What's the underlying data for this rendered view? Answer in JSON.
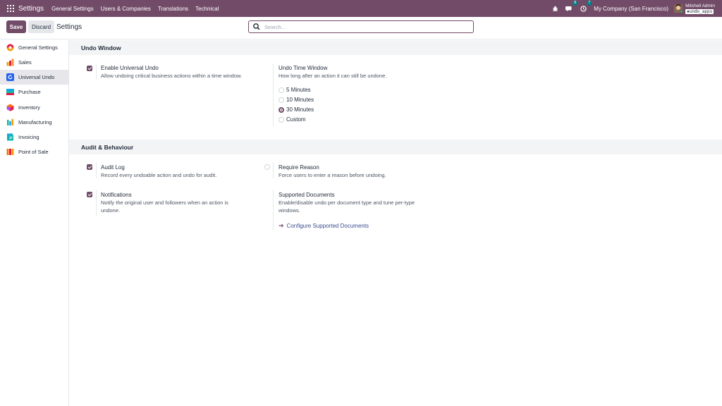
{
  "navbar": {
    "brand": "Settings",
    "menu": [
      "General Settings",
      "Users & Companies",
      "Translations",
      "Technical"
    ],
    "messages_count": "8",
    "activities_count": "7",
    "company": "My Company (San Francisco)",
    "user_name": "Mitchell Admin",
    "database": "undo_apps"
  },
  "control_panel": {
    "save_label": "Save",
    "discard_label": "Discard",
    "title": "Settings",
    "search_placeholder": "Search..."
  },
  "sidebar": {
    "items": [
      {
        "label": "General Settings",
        "icon": "general-settings-icon",
        "active": false
      },
      {
        "label": "Sales",
        "icon": "sales-icon",
        "active": false
      },
      {
        "label": "Universal Undo",
        "icon": "universal-undo-icon",
        "active": true
      },
      {
        "label": "Purchase",
        "icon": "purchase-icon",
        "active": false
      },
      {
        "label": "Inventory",
        "icon": "inventory-icon",
        "active": false
      },
      {
        "label": "Manufacturing",
        "icon": "manufacturing-icon",
        "active": false
      },
      {
        "label": "Invoicing",
        "icon": "invoicing-icon",
        "active": false
      },
      {
        "label": "Point of Sale",
        "icon": "point-of-sale-icon",
        "active": false
      }
    ]
  },
  "sections": {
    "undo_window": {
      "title": "Undo Window",
      "enable": {
        "title": "Enable Universal Undo",
        "desc": "Allow undoing critical business actions within a time window.",
        "checked": true
      },
      "time_window": {
        "title": "Undo Time Window",
        "desc": "How long after an action it can still be undone.",
        "options": [
          "5 Minutes",
          "10 Minutes",
          "30 Minutes",
          "Custom"
        ],
        "selected": "30 Minutes"
      }
    },
    "audit": {
      "title": "Audit & Behaviour",
      "audit_log": {
        "title": "Audit Log",
        "desc": "Record every undoable action and undo for audit.",
        "checked": true
      },
      "require_reason": {
        "title": "Require Reason",
        "desc": "Force users to enter a reason before undoing.",
        "checked": false
      },
      "notifications": {
        "title": "Notifications",
        "desc": "Notify the original user and followers when an action is undone.",
        "checked": true
      },
      "supported_docs": {
        "title": "Supported Documents",
        "desc": "Enable/disable undo per document type and tune per-type windows.",
        "link": "Configure Supported Documents"
      }
    }
  },
  "colors": {
    "brand": "#714B67",
    "badge": "#017E84",
    "link": "#3f4d8f"
  }
}
